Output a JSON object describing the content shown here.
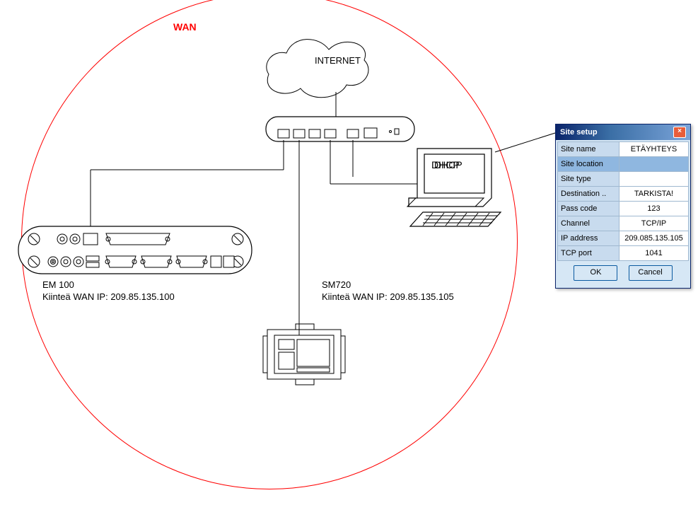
{
  "wan_label": "WAN",
  "internet_label": "INTERNET",
  "dhcp_label": "DHCP",
  "em100": {
    "name": "EM 100",
    "ip_label": "Kiinteä WAN IP: 209.85.135.100"
  },
  "sm720": {
    "name": "SM720",
    "ip_label": "Kiinteä WAN IP: 209.85.135.105"
  },
  "dialog": {
    "title": "Site setup",
    "close": "×",
    "rows": [
      {
        "k": "Site name",
        "v": "ETÄYHTEYS"
      },
      {
        "k": "Site location",
        "v": "",
        "hl": true
      },
      {
        "k": "Site type",
        "v": ""
      },
      {
        "k": "Destination ..",
        "v": "TARKISTA!"
      },
      {
        "k": "Pass code",
        "v": "123"
      },
      {
        "k": "Channel",
        "v": "TCP/IP"
      },
      {
        "k": "IP address",
        "v": "209.085.135.105"
      },
      {
        "k": "TCP port",
        "v": "1041"
      }
    ],
    "ok": "OK",
    "cancel": "Cancel"
  }
}
